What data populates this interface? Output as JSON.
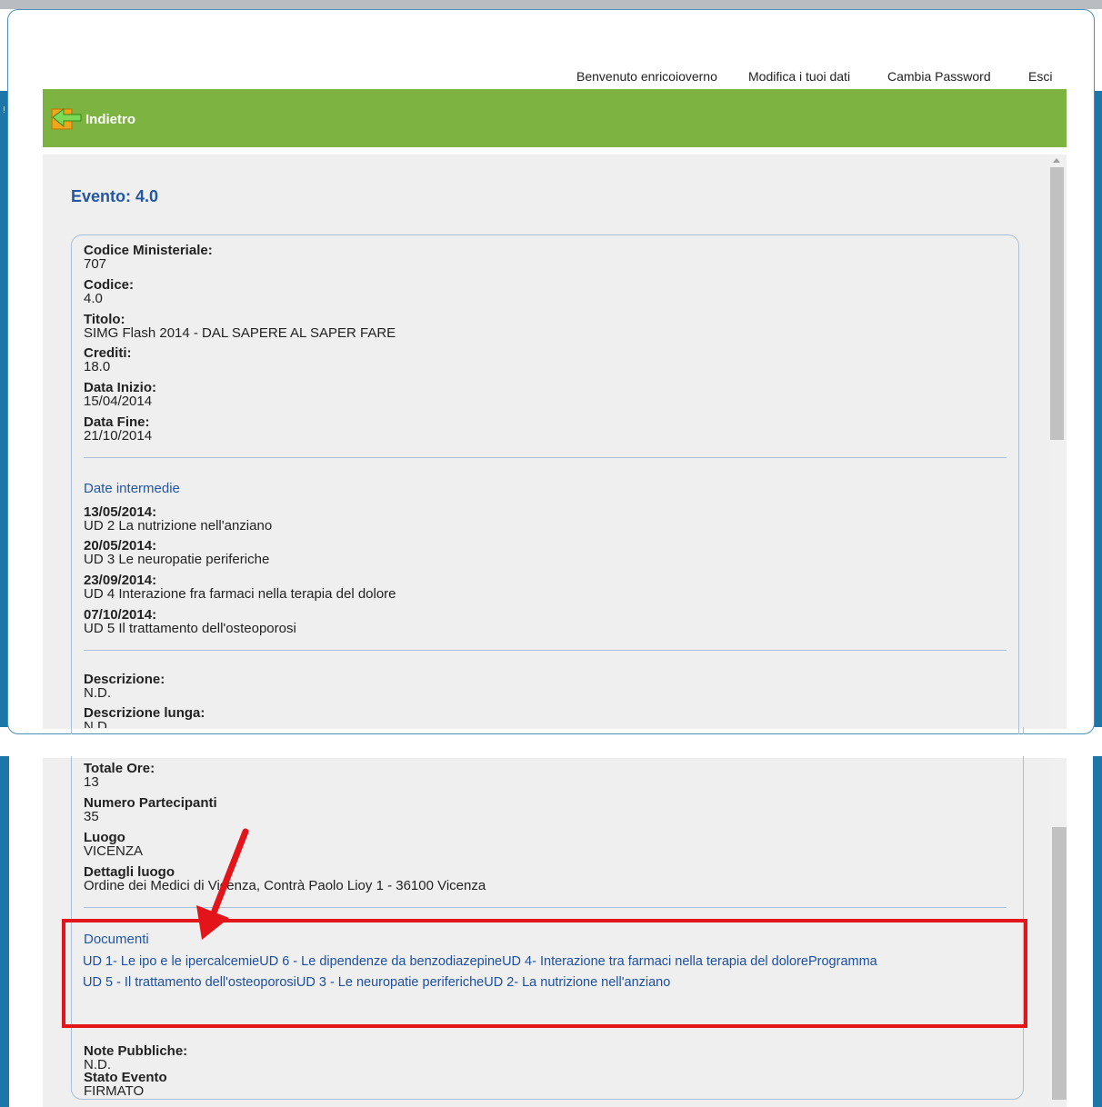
{
  "user": {
    "welcome": "Benvenuto enricoioverno",
    "edit_profile": "Modifica i tuoi dati",
    "change_password": "Cambia Password",
    "logout": "Esci"
  },
  "toolbar": {
    "back_label": "Indietro"
  },
  "event": {
    "title": "Evento: 4.0",
    "fields": [
      {
        "label": "Codice Ministeriale:",
        "value": "707"
      },
      {
        "label": "Codice:",
        "value": "4.0"
      },
      {
        "label": "Titolo:",
        "value": "SIMG Flash 2014 - DAL SAPERE AL SAPER FARE"
      },
      {
        "label": "Crediti:",
        "value": "18.0"
      },
      {
        "label": "Data Inizio:",
        "value": "15/04/2014"
      },
      {
        "label": "Data Fine:",
        "value": "21/10/2014"
      }
    ],
    "intermediate": {
      "title": "Date intermedie",
      "items": [
        {
          "date": "13/05/2014:",
          "text": "UD 2 La nutrizione nell'anziano"
        },
        {
          "date": "20/05/2014:",
          "text": "UD 3 Le neuropatie periferiche"
        },
        {
          "date": "23/09/2014:",
          "text": "UD 4 Interazione fra farmaci nella terapia del dolore"
        },
        {
          "date": "07/10/2014:",
          "text": "UD 5 Il trattamento dell'osteoporosi"
        }
      ]
    },
    "description": [
      {
        "label": "Descrizione:",
        "value": "N.D."
      },
      {
        "label": "Descrizione lunga:",
        "value": "N.D"
      }
    ],
    "details": [
      {
        "label": "Totale Ore:",
        "value": "13"
      },
      {
        "label": "Numero Partecipanti",
        "value": "35"
      },
      {
        "label": "Luogo",
        "value": "VICENZA"
      },
      {
        "label": "Dettagli luogo",
        "value": "Ordine dei Medici di Vicenza, Contrà Paolo Lioy 1 - 36100 Vicenza"
      }
    ],
    "documents": {
      "title": "Documenti",
      "links": [
        "UD 1- Le ipo e le ipercalcemie",
        "UD 6 - Le dipendenze da benzodiazepine",
        "UD 4- Interazione tra farmaci nella terapia del dolore",
        "Programma",
        "UD 5 - Il trattamento dell'osteoporosi",
        "UD 3 - Le neuropatie periferiche",
        "UD 2- La nutrizione nell'anziano"
      ]
    },
    "footer": [
      {
        "label": "Note Pubbliche:",
        "value": "N.D."
      },
      {
        "label": "Stato Evento",
        "value": "FIRMATO"
      }
    ]
  },
  "colors": {
    "green_bar": "#7cb341",
    "link_blue": "#1e4fa0",
    "title_blue": "#2356a5",
    "highlight_red": "#e4141b"
  },
  "icons": [
    "back-arrow-icon",
    "scroll-up-icon",
    "annotation-arrow"
  ]
}
